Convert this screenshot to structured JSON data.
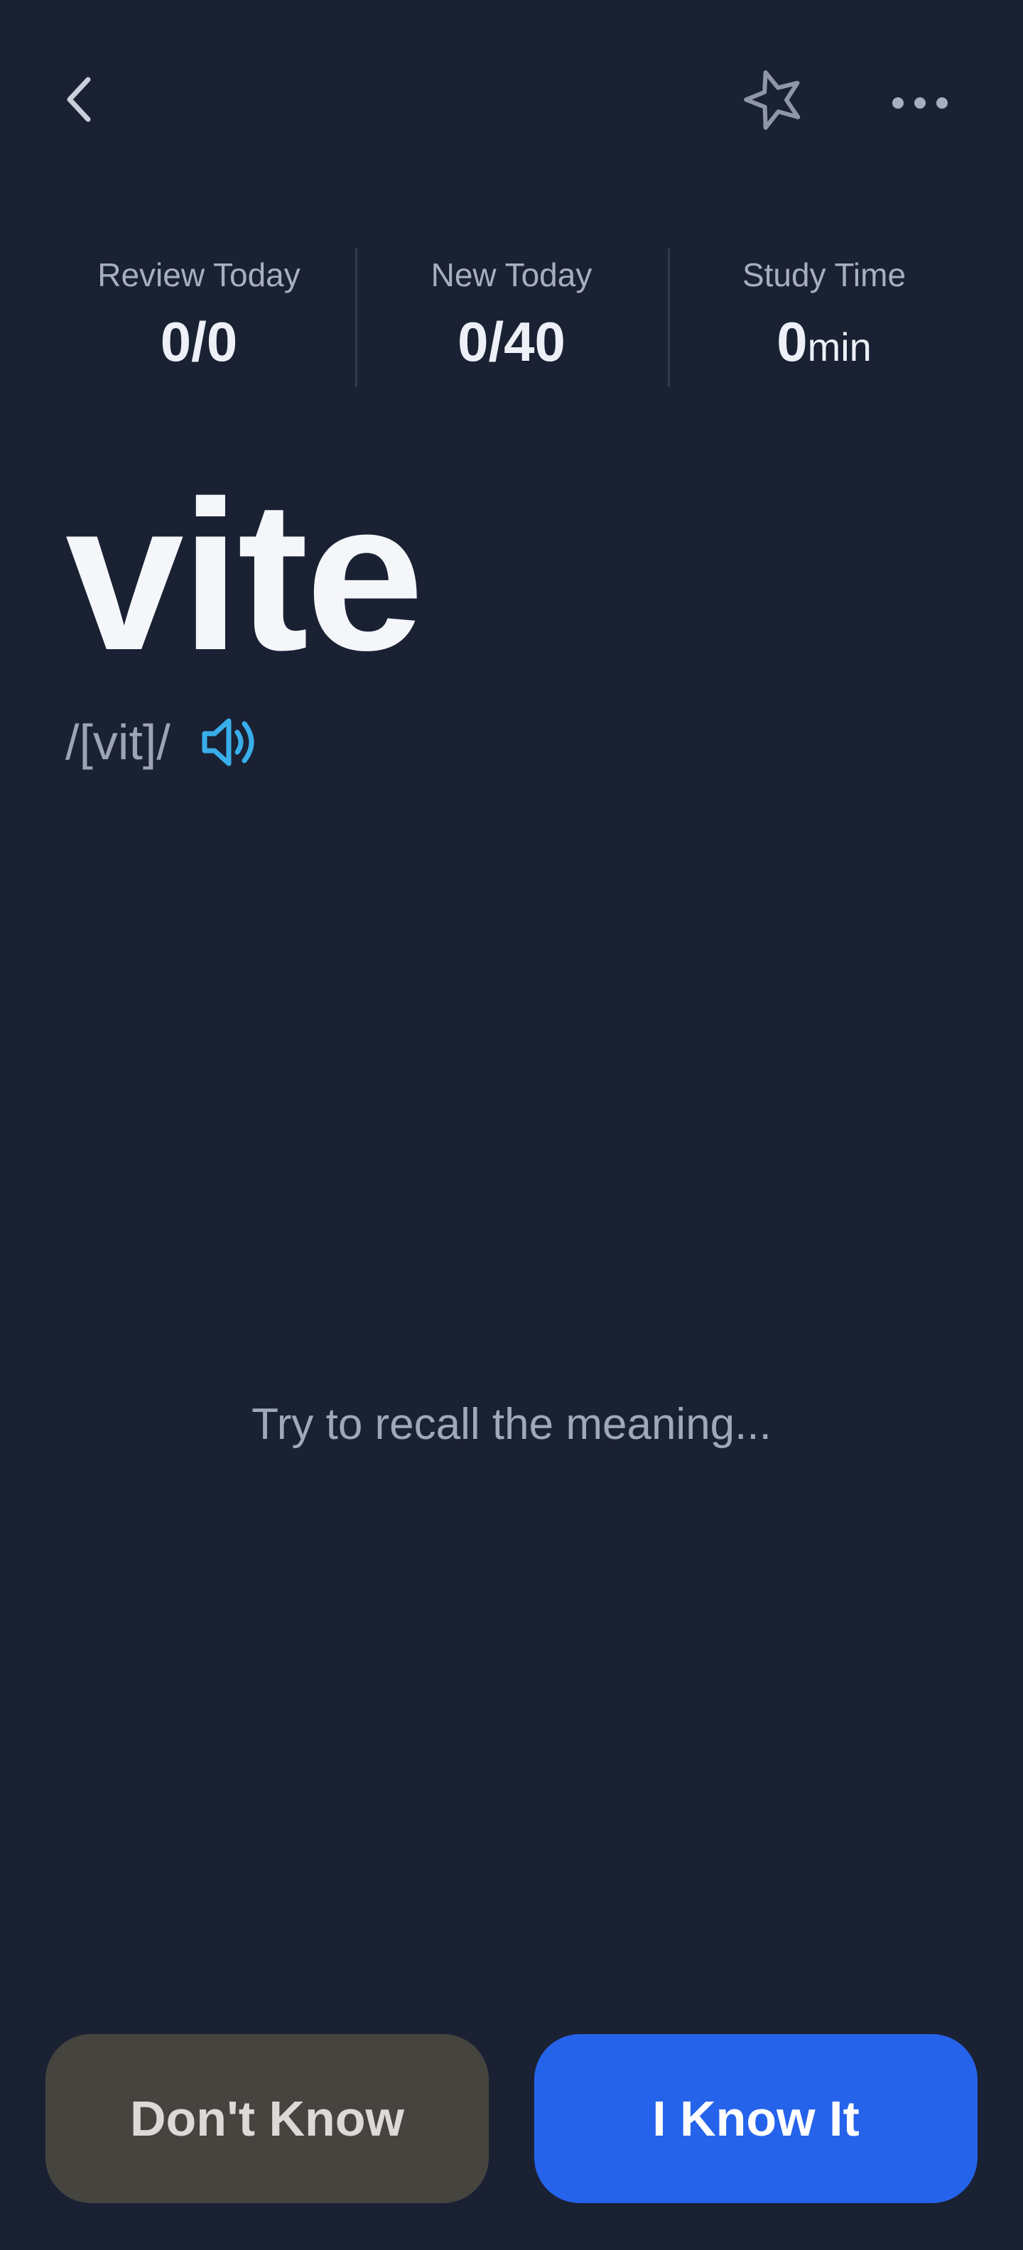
{
  "header": {
    "back_icon": "chevron-left-icon",
    "favorite_icon": "star-outline-icon",
    "more_icon": "more-dots-icon"
  },
  "stats": [
    {
      "label": "Review Today",
      "value": "0/0",
      "unit": ""
    },
    {
      "label": "New Today",
      "value": "0/40",
      "unit": ""
    },
    {
      "label": "Study Time",
      "value": "0",
      "unit": "min"
    }
  ],
  "card": {
    "word": "vite",
    "phonetic": "/[vit]/",
    "speaker_icon": "speaker-icon",
    "hint": "Try to recall the meaning..."
  },
  "actions": {
    "dont_know_label": "Don't Know",
    "know_label": "I Know It"
  },
  "colors": {
    "background": "#1a2133",
    "accent": "#2563eb",
    "speaker": "#38aeea",
    "secondary_button": "#46443f"
  }
}
